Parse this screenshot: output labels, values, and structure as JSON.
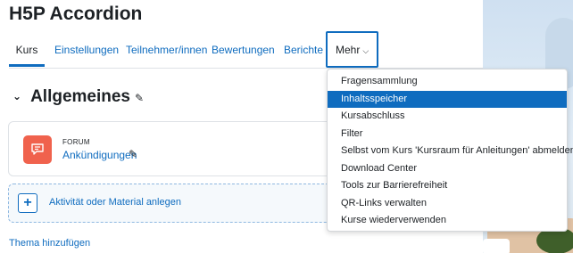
{
  "page_title": "H5P Accordion",
  "tabs": [
    {
      "label": "Kurs",
      "active": true
    },
    {
      "label": "Einstellungen"
    },
    {
      "label": "Teilnehmer/innen"
    },
    {
      "label": "Bewertungen"
    },
    {
      "label": "Berichte"
    },
    {
      "label": "Mehr",
      "open": true
    }
  ],
  "section": {
    "title": "Allgemeines",
    "expanded": true
  },
  "activity": {
    "type": "FORUM",
    "name": "Ankündigungen",
    "icon": "forum-icon"
  },
  "add_activity_label": "Aktivität oder Material anlegen",
  "add_topic_label": "Thema hinzufügen",
  "more_menu": {
    "items": [
      {
        "label": "Fragensammlung"
      },
      {
        "label": "Inhaltsspeicher",
        "highlighted": true
      },
      {
        "label": "Kursabschluss"
      },
      {
        "label": "Filter"
      },
      {
        "label": "Selbst vom Kurs 'Kursraum für Anleitungen' abmelden"
      },
      {
        "label": "Download Center"
      },
      {
        "label": "Tools zur Barrierefreiheit"
      },
      {
        "label": "QR-Links verwalten"
      },
      {
        "label": "Kurse wiederverwenden"
      }
    ]
  },
  "colors": {
    "link": "#0f6cbf",
    "forum_icon_bg": "#f0624d",
    "highlight": "#0f6cbf"
  }
}
